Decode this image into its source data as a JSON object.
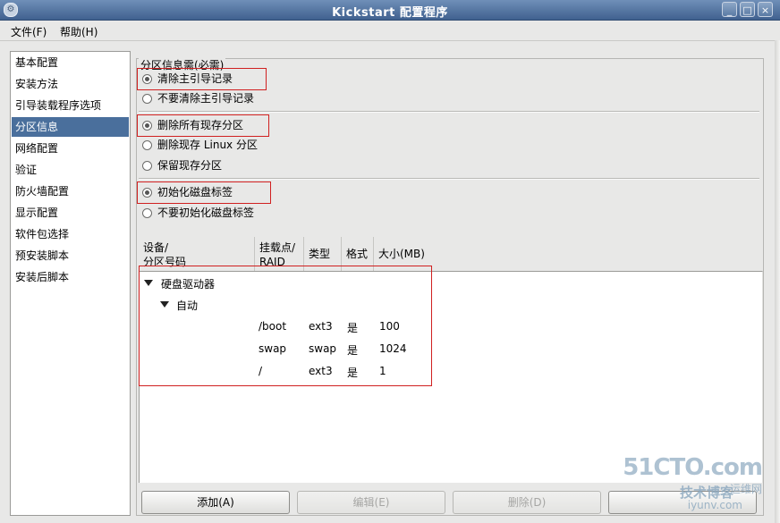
{
  "window": {
    "title": "Kickstart 配置程序",
    "buttons": {
      "minimize": "_",
      "maximize": "□",
      "close": "×"
    }
  },
  "menu": [
    "文件(F)",
    "帮助(H)"
  ],
  "sidebar": {
    "items": [
      {
        "label": "基本配置"
      },
      {
        "label": "安装方法"
      },
      {
        "label": "引导装载程序选项"
      },
      {
        "label": "分区信息",
        "selected": true
      },
      {
        "label": "网络配置"
      },
      {
        "label": "验证"
      },
      {
        "label": "防火墙配置"
      },
      {
        "label": "显示配置"
      },
      {
        "label": "软件包选择"
      },
      {
        "label": "预安装脚本"
      },
      {
        "label": "安装后脚本"
      }
    ]
  },
  "partition": {
    "group_label": "分区信息需(必需)",
    "mbr": [
      {
        "label": "清除主引导记录",
        "checked": true
      },
      {
        "label": "不要清除主引导记录",
        "checked": false
      }
    ],
    "existing": [
      {
        "label": "删除所有现存分区",
        "checked": true
      },
      {
        "label": "删除现存 Linux 分区",
        "checked": false
      },
      {
        "label": "保留现存分区",
        "checked": false
      }
    ],
    "disklabel": [
      {
        "label": "初始化磁盘标签",
        "checked": true
      },
      {
        "label": "不要初始化磁盘标签",
        "checked": false
      }
    ],
    "columns": {
      "device_l1": "设备/",
      "device_l2": "分区号码",
      "mount_l1": "挂载点/",
      "mount_l2": "RAID",
      "type": "类型",
      "format": "格式",
      "size": "大小(MB)"
    },
    "tree": {
      "root": "硬盘驱动器",
      "child": "自动",
      "rows": [
        {
          "mount": "/boot",
          "type": "ext3",
          "format": "是",
          "size": "100"
        },
        {
          "mount": "swap",
          "type": "swap",
          "format": "是",
          "size": "1024"
        },
        {
          "mount": "/",
          "type": "ext3",
          "format": "是",
          "size": "1"
        }
      ]
    },
    "buttons": {
      "add": "添加(A)",
      "edit": "编辑(E)",
      "delete": "删除(D)"
    }
  },
  "watermark": {
    "line1": "51CTO.com",
    "line2": "技术博客",
    "line3": "运维网",
    "line4": "iyunv.com"
  },
  "colors": {
    "selection": "#4a6f9c",
    "highlight_box": "#d02020",
    "titlebar": "#40618f"
  }
}
